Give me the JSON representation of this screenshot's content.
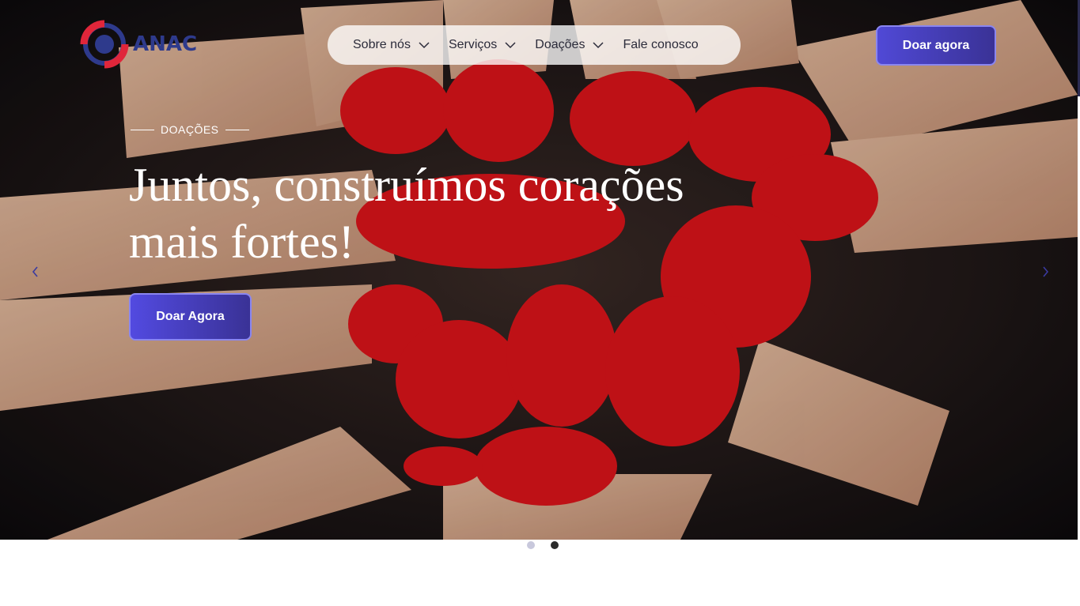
{
  "brand": {
    "name": "ANAC",
    "text_color": "#2e3a8c",
    "ring_red": "#e0263a",
    "ring_blue": "#2e3a8c"
  },
  "nav": {
    "items": [
      {
        "label": "Sobre nós",
        "icon": "chevron-down-icon"
      },
      {
        "label": "Serviços",
        "icon": "chevron-down-icon"
      },
      {
        "label": "Doações",
        "icon": "chevron-down-icon"
      },
      {
        "label": "Fale conosco"
      }
    ]
  },
  "header": {
    "cta_label": "Doar agora"
  },
  "hero": {
    "eyebrow": "DOAÇÕES",
    "title": "Juntos, construímos corações mais fortes!",
    "cta_label": "Doar Agora",
    "background": "hands-painted-red-heart-photo",
    "prev_icon": "chevron-left-icon",
    "next_icon": "chevron-right-icon"
  },
  "carousel": {
    "slide_count": 2,
    "active_index": 1
  },
  "colors": {
    "accent": "#4f48d6",
    "accent_dark": "#3a3296",
    "dot_inactive": "#c8c8dc",
    "dot_active": "#2b2b2b"
  }
}
